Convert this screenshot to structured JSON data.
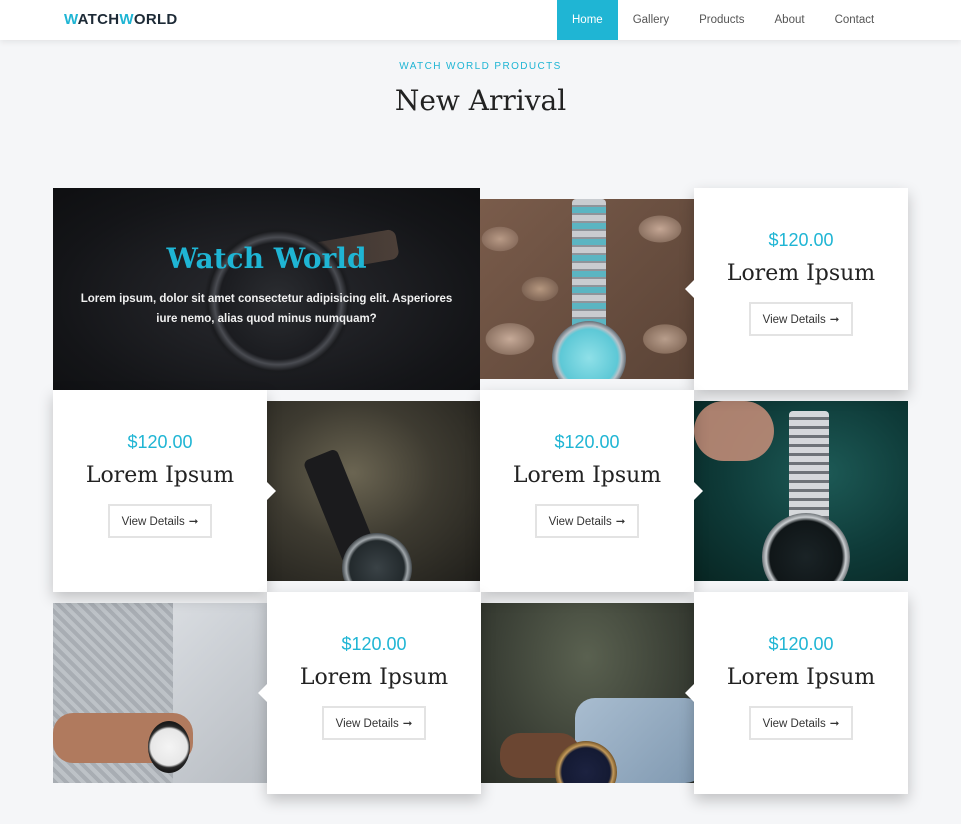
{
  "nav": {
    "logo_part1": "W",
    "logo_part2": "ATCH",
    "logo_part3": "W",
    "logo_part4": "ORLD",
    "items": [
      {
        "label": "Home",
        "active": true
      },
      {
        "label": "Gallery",
        "active": false
      },
      {
        "label": "Products",
        "active": false
      },
      {
        "label": "About",
        "active": false
      },
      {
        "label": "Contact",
        "active": false
      }
    ]
  },
  "heading": {
    "eyebrow": "WATCH WORLD PRODUCTS",
    "title": "New Arrival"
  },
  "hero": {
    "title": "Watch World",
    "text": "Lorem ipsum, dolor sit amet consectetur adipisicing elit. Asperiores iure nemo, alias quod minus numquam?"
  },
  "products": [
    {
      "price": "$120.00",
      "name": "Lorem Ipsum",
      "button": "View Details"
    },
    {
      "price": "$120.00",
      "name": "Lorem Ipsum",
      "button": "View Details"
    },
    {
      "price": "$120.00",
      "name": "Lorem Ipsum",
      "button": "View Details"
    },
    {
      "price": "$120.00",
      "name": "Lorem Ipsum",
      "button": "View Details"
    },
    {
      "price": "$120.00",
      "name": "Lorem Ipsum",
      "button": "View Details"
    }
  ],
  "colors": {
    "accent": "#1fb5d4",
    "nav_active_bg": "#1fb5d4",
    "text_dark": "#222222"
  },
  "icons": {
    "button_arrow": "arrow-right-icon"
  }
}
